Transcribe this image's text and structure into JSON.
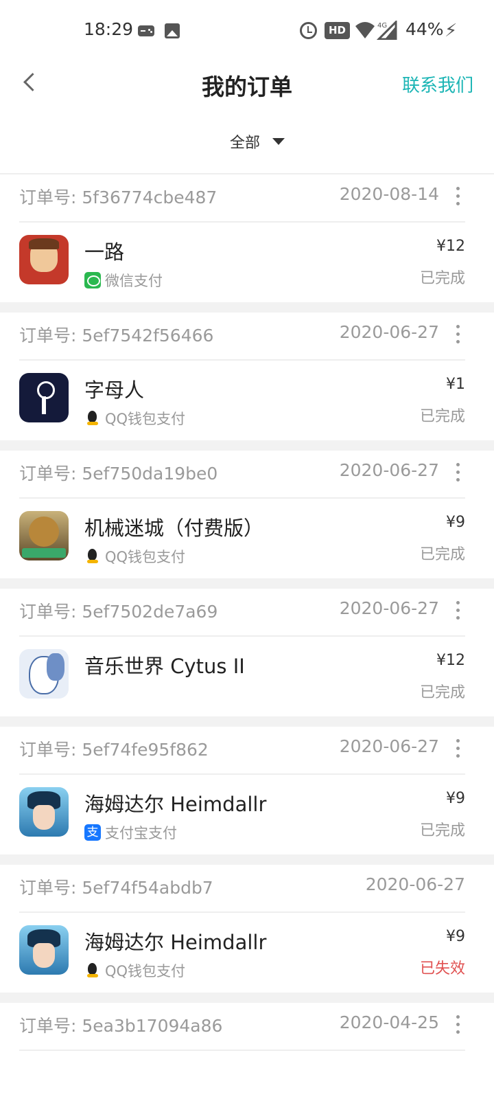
{
  "status_bar": {
    "time": "18:29",
    "hd_label": "HD",
    "network_label": "4G",
    "battery": "44%",
    "icons": [
      "gamepad-icon",
      "image-icon",
      "alarm-icon",
      "hd-icon",
      "wifi-icon",
      "signal-icon",
      "charging-icon"
    ]
  },
  "header": {
    "title": "我的订单",
    "contact": "联系我们",
    "accent_color": "#1cb5b5"
  },
  "filter": {
    "selected": "全部"
  },
  "orders": [
    {
      "order_no_label": "订单号: 5f36774cbe487",
      "date": "2020-08-14",
      "has_more": true,
      "app_name": "一路",
      "payment": "微信支付",
      "payment_icon": "wechat-pay-icon",
      "price": "¥12",
      "status": "已完成"
    },
    {
      "order_no_label": "订单号: 5ef7542f56466",
      "date": "2020-06-27",
      "has_more": true,
      "app_name": "字母人",
      "payment": "QQ钱包支付",
      "payment_icon": "qq-wallet-icon",
      "price": "¥1",
      "status": "已完成"
    },
    {
      "order_no_label": "订单号: 5ef750da19be0",
      "date": "2020-06-27",
      "has_more": true,
      "app_name": "机械迷城（付费版）",
      "payment": "QQ钱包支付",
      "payment_icon": "qq-wallet-icon",
      "price": "¥9",
      "status": "已完成"
    },
    {
      "order_no_label": "订单号: 5ef7502de7a69",
      "date": "2020-06-27",
      "has_more": true,
      "app_name": "音乐世界 Cytus II",
      "payment": "",
      "payment_icon": "",
      "price": "¥12",
      "status": "已完成"
    },
    {
      "order_no_label": "订单号: 5ef74fe95f862",
      "date": "2020-06-27",
      "has_more": true,
      "app_name": "海姆达尔 Heimdallr",
      "payment": "支付宝支付",
      "payment_icon": "alipay-icon",
      "price": "¥9",
      "status": "已完成"
    },
    {
      "order_no_label": "订单号: 5ef74f54abdb7",
      "date": "2020-06-27",
      "has_more": false,
      "app_name": "海姆达尔 Heimdallr",
      "payment": "QQ钱包支付",
      "payment_icon": "qq-wallet-icon",
      "price": "¥9",
      "status": "已失效",
      "status_color": "#e05050"
    },
    {
      "order_no_label": "订单号: 5ea3b17094a86",
      "date": "2020-04-25",
      "has_more": true
    }
  ]
}
